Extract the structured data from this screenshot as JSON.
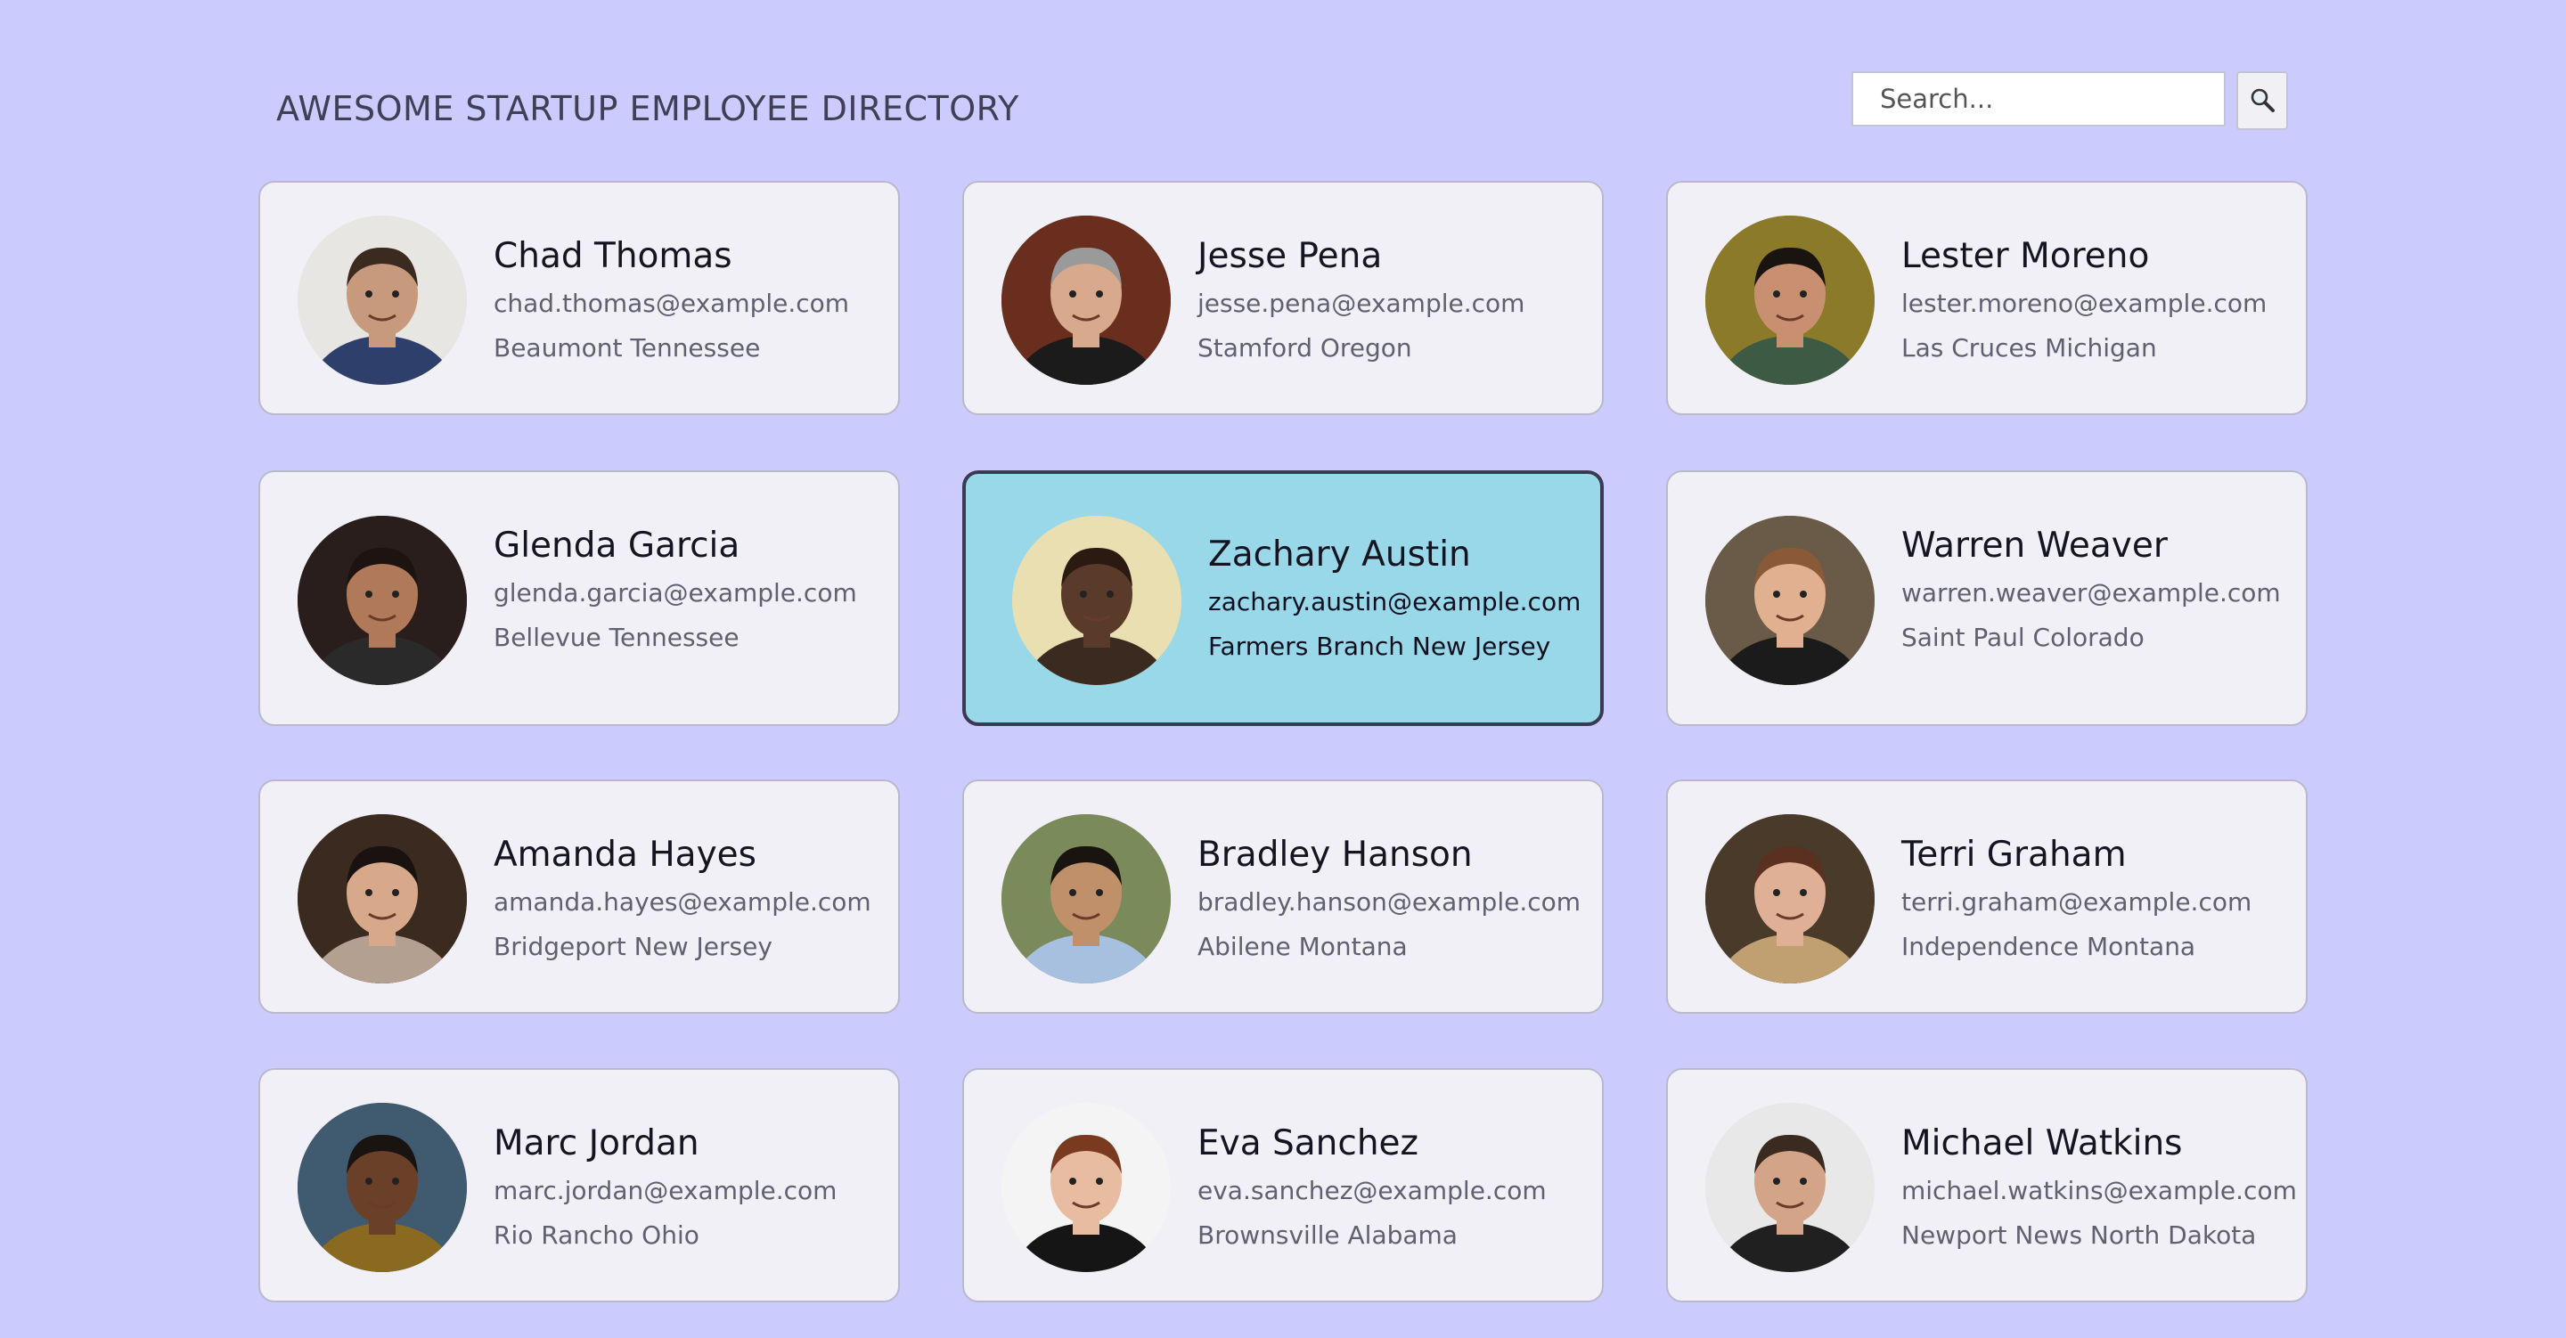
{
  "header": {
    "title": "AWESOME STARTUP EMPLOYEE DIRECTORY",
    "search_placeholder": "Search...",
    "search_icon": "magnifier-icon"
  },
  "employees": [
    {
      "name": "Chad Thomas",
      "email": "chad.thomas@example.com",
      "location": "Beaumont Tennessee",
      "skin": "#c79a7e",
      "hair": "#3b2a20",
      "shirt": "#2d3f6a",
      "bg": "#e8e6e2",
      "active": false
    },
    {
      "name": "Jesse Pena",
      "email": "jesse.pena@example.com",
      "location": "Stamford Oregon",
      "skin": "#d8a98c",
      "hair": "#9a9a9a",
      "shirt": "#1b1b1b",
      "bg": "#6a2e1f",
      "active": false
    },
    {
      "name": "Lester Moreno",
      "email": "lester.moreno@example.com",
      "location": "Las Cruces Michigan",
      "skin": "#c89070",
      "hair": "#1a1410",
      "shirt": "#3d5a45",
      "bg": "#8a7a2a",
      "active": false
    },
    {
      "name": "Glenda Garcia",
      "email": "glenda.garcia@example.com",
      "location": "Bellevue Tennessee",
      "skin": "#b07a5a",
      "hair": "#1d1412",
      "shirt": "#2a2a2a",
      "bg": "#2a1e1c",
      "active": false
    },
    {
      "name": "Zachary Austin",
      "email": "zachary.austin@example.com",
      "location": "Farmers Branch New Jersey",
      "skin": "#5a3a28",
      "hair": "#2a1a12",
      "shirt": "#3a2a20",
      "bg": "#e9dfb0",
      "active": true
    },
    {
      "name": "Warren Weaver",
      "email": "warren.weaver@example.com",
      "location": "Saint Paul Colorado",
      "skin": "#e0b090",
      "hair": "#8a5a38",
      "shirt": "#1b1b1b",
      "bg": "#6a5a48",
      "active": false
    },
    {
      "name": "Amanda Hayes",
      "email": "amanda.hayes@example.com",
      "location": "Bridgeport New Jersey",
      "skin": "#d8a88a",
      "hair": "#1a1210",
      "shirt": "#b4a090",
      "bg": "#3a2a20",
      "active": false
    },
    {
      "name": "Bradley Hanson",
      "email": "bradley.hanson@example.com",
      "location": "Abilene Montana",
      "skin": "#c0906a",
      "hair": "#1a1410",
      "shirt": "#a8c0e0",
      "bg": "#7a8a5a",
      "active": false
    },
    {
      "name": "Terri Graham",
      "email": "terri.graham@example.com",
      "location": "Independence Montana",
      "skin": "#e0b096",
      "hair": "#5a3020",
      "shirt": "#c0a070",
      "bg": "#4a3a2a",
      "active": false
    },
    {
      "name": "Marc Jordan",
      "email": "marc.jordan@example.com",
      "location": "Rio Rancho Ohio",
      "skin": "#6a4028",
      "hair": "#1a1410",
      "shirt": "#8a6a20",
      "bg": "#405a70",
      "active": false
    },
    {
      "name": "Eva Sanchez",
      "email": "eva.sanchez@example.com",
      "location": "Brownsville Alabama",
      "skin": "#e8bca0",
      "hair": "#7a3a20",
      "shirt": "#151515",
      "bg": "#f4f4f4",
      "active": false
    },
    {
      "name": "Michael Watkins",
      "email": "michael.watkins@example.com",
      "location": "Newport News North Dakota",
      "skin": "#d4a488",
      "hair": "#3a2a20",
      "shirt": "#202020",
      "bg": "#e8e8e8",
      "active": false
    }
  ]
}
